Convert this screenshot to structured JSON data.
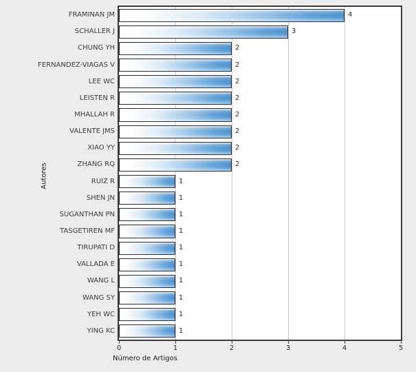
{
  "chart_data": {
    "type": "bar",
    "orientation": "horizontal",
    "title": "",
    "xlabel": "Número de Artigos",
    "ylabel": "Autores",
    "xlim": [
      0,
      5
    ],
    "xticks": [
      "0",
      "1",
      "2",
      "3",
      "4",
      "5"
    ],
    "grid": true,
    "legend": null,
    "categories": [
      "FRAMINAN JM",
      "SCHALLER J",
      "CHUNG YH",
      "FERNANDEZ-VIAGAS V",
      "LEE WC",
      "LEISTEN R",
      "MHALLAH R",
      "VALENTE JMS",
      "XIAO YY",
      "ZHANG RQ",
      "RUIZ R",
      "SHEN JN",
      "SUGANTHAN PN",
      "TASGETIREN MF",
      "TIRUPATI D",
      "VALLADA E",
      "WANG L",
      "WANG SY",
      "YEH WC",
      "YING KC"
    ],
    "values": [
      4,
      3,
      2,
      2,
      2,
      2,
      2,
      2,
      2,
      2,
      1,
      1,
      1,
      1,
      1,
      1,
      1,
      1,
      1,
      1
    ],
    "value_labels": [
      "4",
      "3",
      "2",
      "2",
      "2",
      "2",
      "2",
      "2",
      "2",
      "2",
      "1",
      "1",
      "1",
      "1",
      "1",
      "1",
      "1",
      "1",
      "1",
      "1"
    ],
    "colors": {
      "bar_gradient_start": "#ffffff",
      "bar_gradient_end": "#4a90cd",
      "bar_border": "#2b2b2b",
      "plot_background": "#ffffff",
      "plot_border": "#3a3a3a",
      "gridline": "#c8c8c8",
      "canvas_background": "#ececec",
      "label_text": "#3d3d3d",
      "axis_text": "#2a2a2a"
    }
  }
}
